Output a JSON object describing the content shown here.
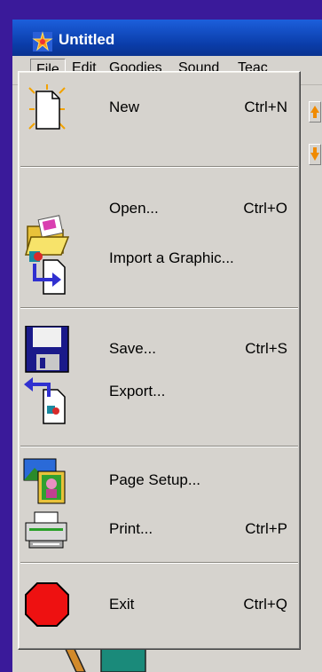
{
  "window": {
    "title": "Untitled"
  },
  "menubar": {
    "items": [
      {
        "label": "File"
      },
      {
        "label": "Edit"
      },
      {
        "label": "Goodies"
      },
      {
        "label": "Sound"
      },
      {
        "label": "Teac"
      }
    ]
  },
  "file_menu": {
    "items": [
      {
        "label": "New",
        "shortcut": "Ctrl+N",
        "icon": "new-document-icon"
      },
      {
        "label": "Open...",
        "shortcut": "Ctrl+O",
        "icon": "open-folder-icon"
      },
      {
        "label": "Import a Graphic...",
        "shortcut": "",
        "icon": "import-graphic-icon"
      },
      {
        "label": "Save...",
        "shortcut": "Ctrl+S",
        "icon": "floppy-disk-icon"
      },
      {
        "label": "Export...",
        "shortcut": "",
        "icon": "export-icon"
      },
      {
        "label": "Page Setup...",
        "shortcut": "",
        "icon": "page-setup-icon"
      },
      {
        "label": "Print...",
        "shortcut": "Ctrl+P",
        "icon": "printer-icon"
      },
      {
        "label": "Exit",
        "shortcut": "Ctrl+Q",
        "icon": "stop-sign-icon"
      }
    ]
  },
  "colors": {
    "desktop": "#3a1a9a",
    "titlebar": "#0a3ca8",
    "menu_bg": "#d6d3ce",
    "exit_icon": "#ee1111",
    "floppy": "#1a1a8a"
  }
}
